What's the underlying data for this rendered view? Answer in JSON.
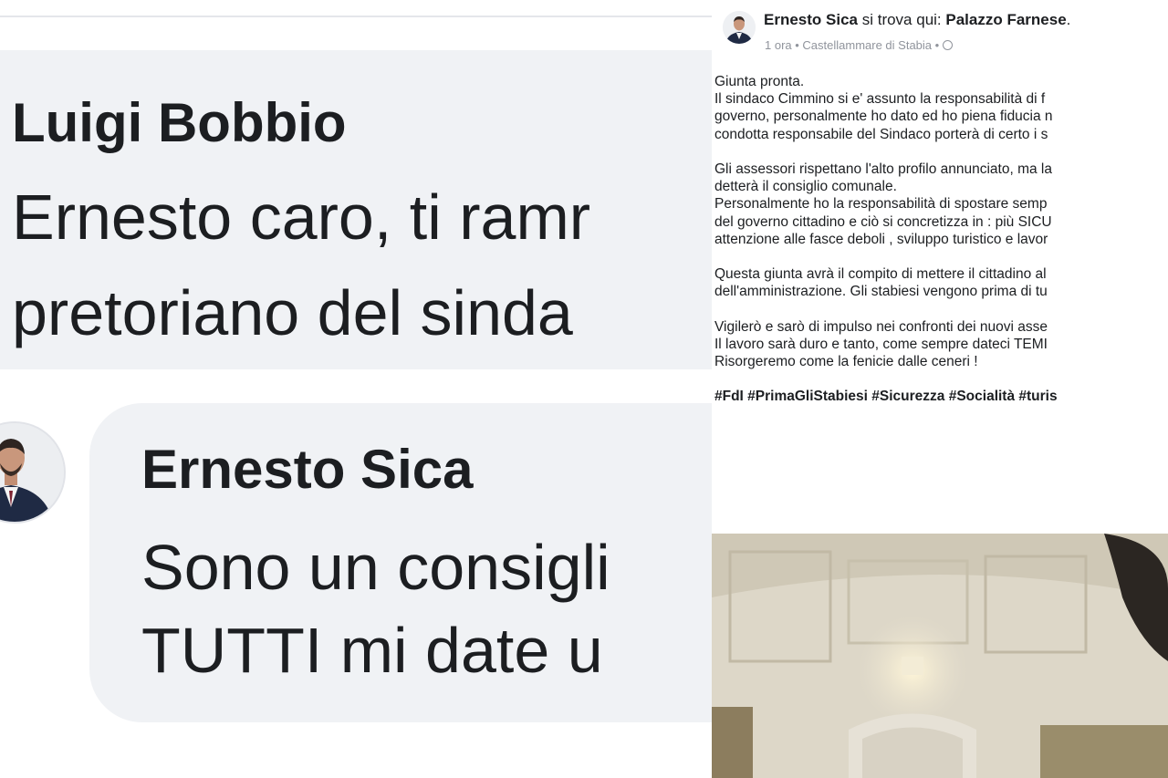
{
  "comments": [
    {
      "author": "Luigi Bobbio",
      "lines": [
        "Ernesto caro, ti ramr",
        "pretoriano del sinda"
      ]
    },
    {
      "author": "Ernesto Sica",
      "lines": [
        "Sono un consigli",
        "TUTTI  mi date u"
      ]
    }
  ],
  "post": {
    "author": "Ernesto Sica",
    "location_prefix": " si trova qui: ",
    "location": "Palazzo Farnese",
    "location_suffix": ".",
    "meta": "1 ora • Castellammare di Stabia • ",
    "privacy_icon": "globe-icon",
    "body_lines": [
      "Giunta pronta.",
      "Il sindaco Cimmino si e' assunto la responsabilità di f",
      "governo, personalmente ho dato ed ho piena fiducia n",
      "condotta responsabile del Sindaco porterà di certo i s",
      "",
      "Gli assessori rispettano l'alto profilo annunciato, ma la",
      "detterà il consiglio comunale.",
      "Personalmente ho la responsabilità di spostare semp",
      "del governo cittadino e ciò si concretizza in : più SICU",
      "attenzione alle fasce deboli , sviluppo turistico e lavor",
      "",
      "Questa giunta avrà il compito di mettere il cittadino al",
      "dell'amministrazione. Gli stabiesi vengono prima di tu",
      "",
      "Vigilerò e sarò di impulso nei confronti dei nuovi asse",
      "Il lavoro sarà  duro e tanto, come sempre dateci TEMI",
      " Risorgeremo come la fenicie dalle ceneri !",
      ""
    ],
    "hashtags": "#FdI #PrimaGliStabiesi #Sicurezza #Socialità #turis"
  },
  "colors": {
    "bubble": "#f0f2f5",
    "text": "#1c1e21",
    "meta": "#90949c"
  }
}
